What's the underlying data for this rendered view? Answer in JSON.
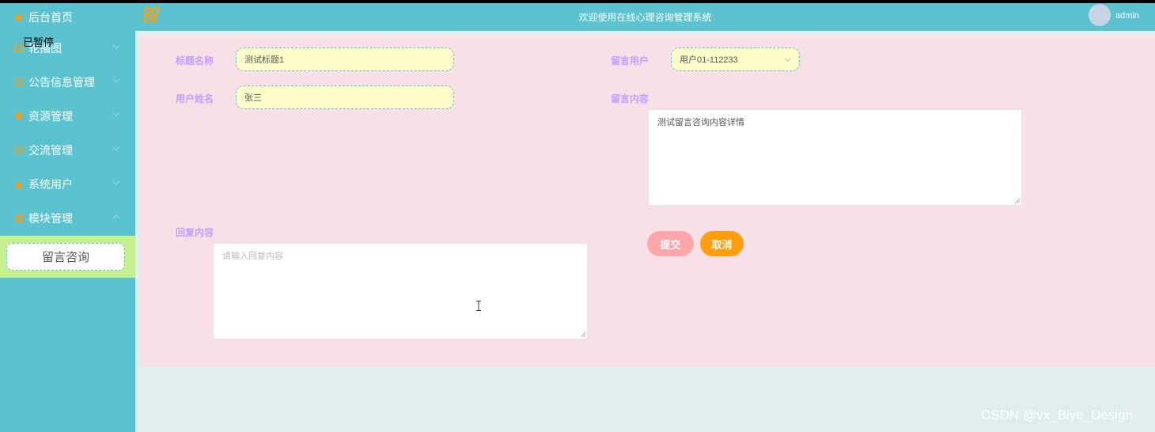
{
  "header": {
    "title": "欢迎使用在线心理咨询管理系统",
    "user": "admin"
  },
  "sidebar": {
    "items": [
      {
        "label": "后台首页",
        "icon": "home-icon"
      },
      {
        "label": "轮播图",
        "icon": "image-icon"
      },
      {
        "label": "公告信息管理",
        "icon": "info-icon"
      },
      {
        "label": "资源管理",
        "icon": "location-icon"
      },
      {
        "label": "交流管理",
        "icon": "chat-icon"
      },
      {
        "label": "系统用户",
        "icon": "user-icon"
      },
      {
        "label": "模块管理",
        "icon": "grid-icon"
      }
    ],
    "overlay_text": "已暂停",
    "submenu_label": "留言咨询"
  },
  "form": {
    "title_label": "标题名称",
    "title_value": "测试标题1",
    "user_label": "留言用户",
    "user_value": "用户01-112233",
    "name_label": "用户姓名",
    "name_value": "张三",
    "content_label": "留言内容",
    "content_value": "测试留言咨询内容详情",
    "reply_label": "回复内容",
    "reply_placeholder": "请输入回复内容",
    "submit_label": "提交",
    "cancel_label": "取消"
  },
  "watermark": "CSDN @vx_Biye_Design",
  "colors": {
    "sidebar": "#5bc3d0",
    "panel": "#f7e1e7",
    "label": "#c79bff",
    "input_bg": "#fffecb",
    "submit": "#ffa6aa",
    "cancel": "#ff9e0e",
    "submenu": "#c5f08e",
    "icon_accent": "#ff9e0e"
  }
}
